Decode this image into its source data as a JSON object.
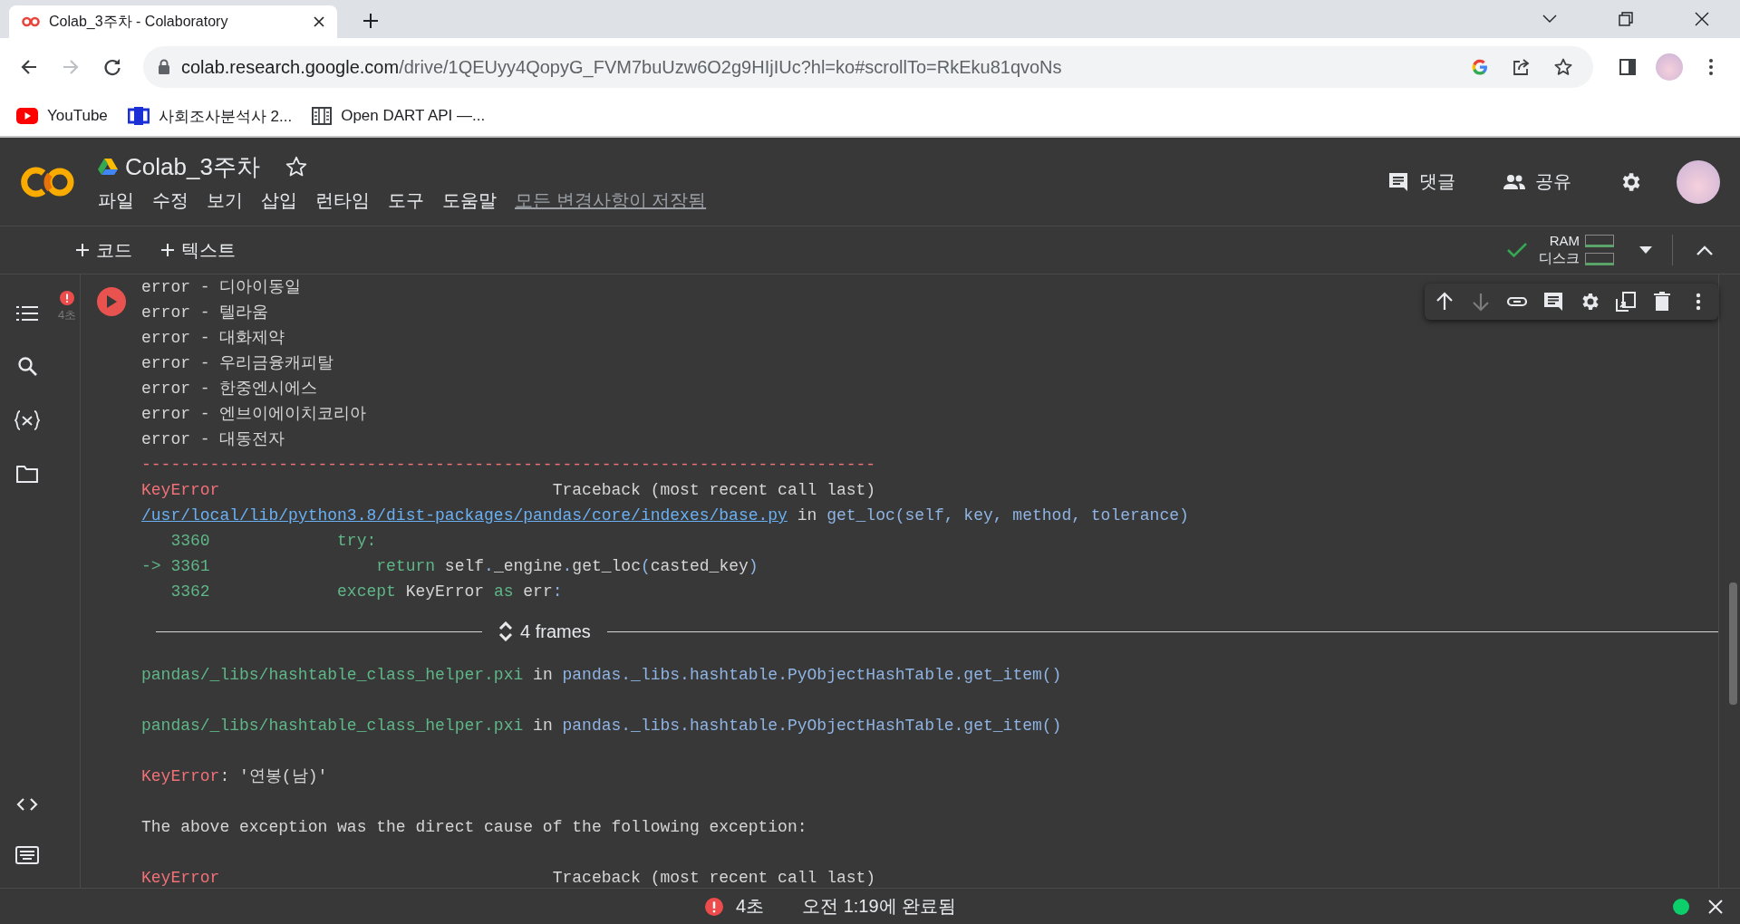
{
  "browser": {
    "tab": {
      "title": "Colab_3주차 - Colaboratory"
    },
    "nav": [
      {
        "kind": "back",
        "disabled": false
      },
      {
        "kind": "forward",
        "disabled": true
      },
      {
        "kind": "reload",
        "disabled": false
      }
    ],
    "address": {
      "host": "colab.research.google.com",
      "path": "/drive/1QEUyy4QopyG_FVM7buUzw6O2g9HIjIUc?hl=ko#scrollTo=RkEku81qvoNs"
    },
    "bookmarks": [
      {
        "kind": "youtube",
        "label": "YouTube"
      },
      {
        "kind": "gsc",
        "label": "사회조사분석사 2..."
      },
      {
        "kind": "dart",
        "label": "Open DART API —..."
      }
    ]
  },
  "notebook": {
    "title": "Colab_3주차",
    "menu": [
      "파일",
      "수정",
      "보기",
      "삽입",
      "런타임",
      "도구",
      "도움말"
    ],
    "save_status": "모든 변경사항이 저장됨",
    "actions": [
      {
        "kind": "comment",
        "label": "댓글"
      },
      {
        "kind": "share",
        "label": "공유"
      }
    ]
  },
  "toolbar": {
    "add_buttons": [
      "코드",
      "텍스트"
    ],
    "resources": [
      "RAM",
      "디스크"
    ]
  },
  "cell": {
    "exec_time": "4초",
    "tools": [
      {
        "kind": "up",
        "disabled": false
      },
      {
        "kind": "down",
        "disabled": true
      },
      {
        "kind": "link",
        "disabled": false
      },
      {
        "kind": "comment",
        "disabled": false
      },
      {
        "kind": "settings",
        "disabled": false
      },
      {
        "kind": "mirror",
        "disabled": false
      },
      {
        "kind": "delete",
        "disabled": false
      },
      {
        "kind": "more",
        "disabled": false
      }
    ],
    "output": [
      {
        "kind": "text",
        "segments": [
          {
            "kind": "plain",
            "text": "error - 디아이동일"
          }
        ]
      },
      {
        "kind": "text",
        "segments": [
          {
            "kind": "plain",
            "text": "error - 텔라움"
          }
        ]
      },
      {
        "kind": "text",
        "segments": [
          {
            "kind": "plain",
            "text": "error - 대화제약"
          }
        ]
      },
      {
        "kind": "text",
        "segments": [
          {
            "kind": "plain",
            "text": "error - 우리금융캐피탈"
          }
        ]
      },
      {
        "kind": "text",
        "segments": [
          {
            "kind": "plain",
            "text": "error - 한중엔시에스"
          }
        ]
      },
      {
        "kind": "text",
        "segments": [
          {
            "kind": "plain",
            "text": "error - 엔브이에이치코리아"
          }
        ]
      },
      {
        "kind": "text",
        "segments": [
          {
            "kind": "plain",
            "text": "error - 대동전자"
          }
        ]
      },
      {
        "kind": "text",
        "segments": [
          {
            "kind": "error",
            "text": "---------------------------------------------------------------------------"
          }
        ]
      },
      {
        "kind": "text",
        "segments": [
          {
            "kind": "error",
            "text": "KeyError"
          },
          {
            "kind": "plain",
            "text": "                                  Traceback (most recent call last)"
          }
        ]
      },
      {
        "kind": "text",
        "segments": [
          {
            "kind": "link",
            "text": "/usr/local/lib/python3.8/dist-packages/pandas/core/indexes/base.py"
          },
          {
            "kind": "plain",
            "text": " in "
          },
          {
            "kind": "name",
            "text": "get_loc(self, key, method, tolerance)"
          }
        ]
      },
      {
        "kind": "text",
        "segments": [
          {
            "kind": "keyword",
            "text": "   3360             try:"
          }
        ]
      },
      {
        "kind": "text",
        "segments": [
          {
            "kind": "keyword",
            "text": "-> 3361                 return"
          },
          {
            "kind": "plain",
            "text": " self"
          },
          {
            "kind": "name",
            "text": "."
          },
          {
            "kind": "plain",
            "text": "_engine"
          },
          {
            "kind": "name",
            "text": "."
          },
          {
            "kind": "plain",
            "text": "get_loc"
          },
          {
            "kind": "name",
            "text": "("
          },
          {
            "kind": "plain",
            "text": "casted_key"
          },
          {
            "kind": "name",
            "text": ")"
          }
        ]
      },
      {
        "kind": "text",
        "segments": [
          {
            "kind": "keyword",
            "text": "   3362             except"
          },
          {
            "kind": "plain",
            "text": " KeyError "
          },
          {
            "kind": "keyword",
            "text": "as"
          },
          {
            "kind": "plain",
            "text": " err"
          },
          {
            "kind": "name",
            "text": ":"
          }
        ]
      },
      {
        "kind": "frames",
        "label": "4 frames"
      },
      {
        "kind": "text",
        "segments": [
          {
            "kind": "keyword",
            "text": "pandas/_libs/hashtable_class_helper.pxi"
          },
          {
            "kind": "plain",
            "text": " in "
          },
          {
            "kind": "name",
            "text": "pandas._libs.hashtable.PyObjectHashTable.get_item()"
          }
        ]
      },
      {
        "kind": "blank"
      },
      {
        "kind": "text",
        "segments": [
          {
            "kind": "keyword",
            "text": "pandas/_libs/hashtable_class_helper.pxi"
          },
          {
            "kind": "plain",
            "text": " in "
          },
          {
            "kind": "name",
            "text": "pandas._libs.hashtable.PyObjectHashTable.get_item()"
          }
        ]
      },
      {
        "kind": "blank"
      },
      {
        "kind": "text",
        "segments": [
          {
            "kind": "error",
            "text": "KeyError"
          },
          {
            "kind": "plain",
            "text": ": '연봉(남)'"
          }
        ]
      },
      {
        "kind": "blank"
      },
      {
        "kind": "text",
        "segments": [
          {
            "kind": "plain",
            "text": "The above exception was the direct cause of the following exception:"
          }
        ]
      },
      {
        "kind": "blank"
      },
      {
        "kind": "text",
        "segments": [
          {
            "kind": "error",
            "text": "KeyError"
          },
          {
            "kind": "plain",
            "text": "                                  Traceback (most recent call last)"
          }
        ]
      }
    ]
  },
  "status_bar": {
    "time": "4초",
    "message": "오전 1:19에 완료됨",
    "connected": true
  }
}
